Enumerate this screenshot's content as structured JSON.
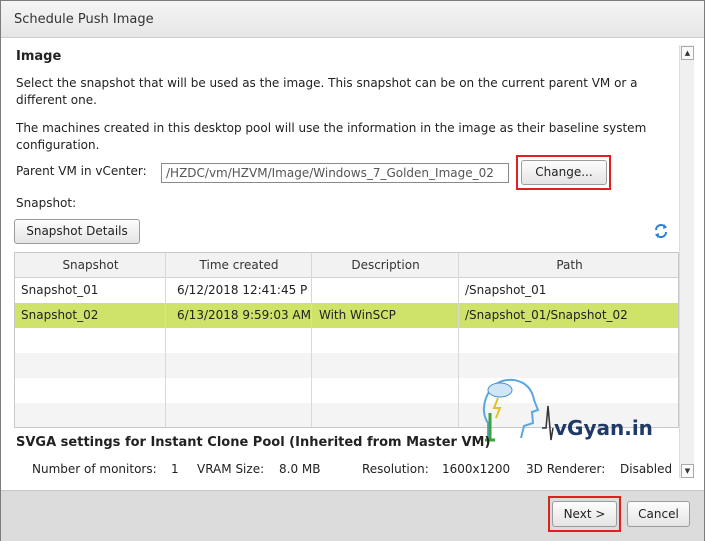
{
  "dialog": {
    "title": "Schedule Push Image"
  },
  "image_section": {
    "heading": "Image",
    "desc1": "Select the snapshot that will be used as the image. This snapshot can be on the current parent VM or a different one.",
    "desc2": "The machines created in this desktop pool will use the information in the image as their baseline system configuration.",
    "parent_vm_label": "Parent VM in vCenter:",
    "parent_vm_value": "/HZDC/vm/HZVM/Image/Windows_7_Golden_Image_02",
    "change_button": "Change...",
    "snapshot_label": "Snapshot:",
    "snapshot_details_button": "Snapshot Details"
  },
  "table": {
    "columns": [
      "Snapshot",
      "Time created",
      "Description",
      "Path"
    ],
    "rows": [
      {
        "snapshot": "Snapshot_01",
        "time": "6/12/2018 12:41:45 P",
        "description": "",
        "path": "/Snapshot_01"
      },
      {
        "snapshot": "Snapshot_02",
        "time": "6/13/2018 9:59:03 AM",
        "description": "With WinSCP",
        "path": "/Snapshot_01/Snapshot_02"
      }
    ],
    "selected_row": 1
  },
  "watermark": {
    "text": "vGyan.in"
  },
  "svga": {
    "heading": "SVGA settings for Instant Clone Pool (Inherited from Master VM)",
    "monitors_label": "Number of monitors:",
    "monitors_value": "1",
    "vram_label": "VRAM Size:",
    "vram_value": "8.0 MB",
    "resolution_label": "Resolution:",
    "resolution_value": "1600x1200",
    "renderer_label": "3D Renderer:",
    "renderer_value": "Disabled"
  },
  "footer": {
    "next_button": "Next >",
    "cancel_button": "Cancel"
  },
  "colors": {
    "highlight": "#e02020",
    "selected_row": "#cfe36a",
    "accent_blue": "#2a7fd4"
  }
}
